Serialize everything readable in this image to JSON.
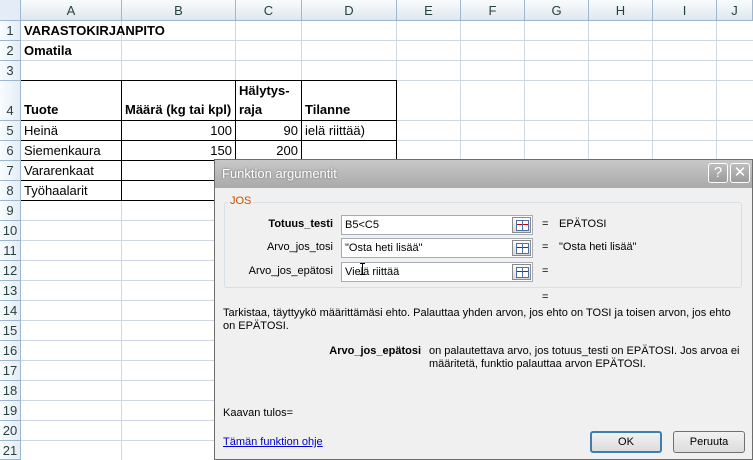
{
  "columns": [
    "A",
    "B",
    "C",
    "D",
    "E",
    "F",
    "G",
    "H",
    "I",
    "J"
  ],
  "rows": [
    "1",
    "2",
    "3",
    "4",
    "5",
    "6",
    "7",
    "8",
    "9",
    "10",
    "11",
    "12",
    "13",
    "14",
    "15",
    "16",
    "17",
    "18",
    "19",
    "20",
    "21"
  ],
  "cells": {
    "A1": "VARASTOKIRJANPITO",
    "A2": "Omatila",
    "A4": "Tuote",
    "B4": "Määrä (kg tai kpl)",
    "C4a": "Hälytys-",
    "C4b": "raja",
    "D4": "Tilanne",
    "A5": "Heinä",
    "B5": "100",
    "C5": "90",
    "D5": "ielä riittää)",
    "A6": "Siemenkaura",
    "B6": "150",
    "C6": "200",
    "A7": "Vararenkaat",
    "A8": "Työhaalarit"
  },
  "dialog": {
    "title": "Funktion argumentit",
    "help_glyph": "?",
    "close_glyph": "✕",
    "function_name": "JOS",
    "args": [
      {
        "label": "Totuus_testi",
        "value": "B5<C5",
        "result": "EPÄTOSI"
      },
      {
        "label": "Arvo_jos_tosi",
        "value": "\"Osta heti lisää\"",
        "result": "\"Osta heti lisää\""
      },
      {
        "label": "Arvo_jos_epätosi",
        "value": "Vielä riittää",
        "result": ""
      }
    ],
    "equals": "=",
    "description": "Tarkistaa, täyttyykö määrittämäsi ehto. Palauttaa yhden arvon, jos ehto on TOSI ja toisen arvon, jos ehto on EPÄTOSI.",
    "arg_help_name": "Arvo_jos_epätosi",
    "arg_help_text": "on palautettava arvo, jos totuus_testi on EPÄTOSI. Jos arvoa ei määritetä, funktio palauttaa arvon EPÄTOSI.",
    "result_label": "Kaavan tulos=",
    "help_link": "Tämän funktion ohje",
    "ok_label": "OK",
    "cancel_label": "Peruuta"
  }
}
